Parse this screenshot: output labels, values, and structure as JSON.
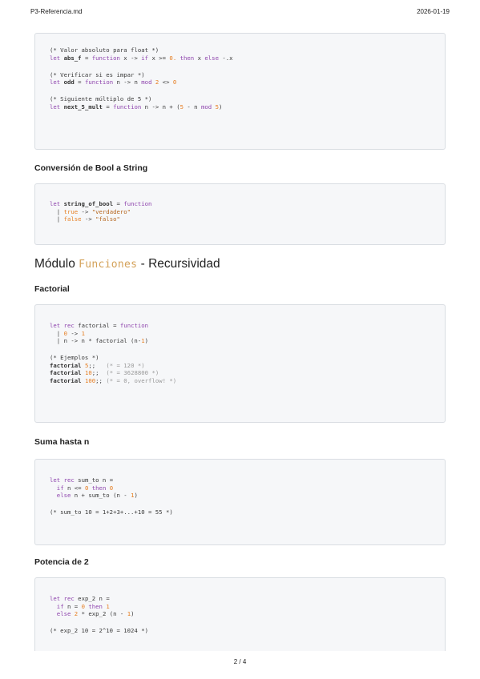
{
  "header": {
    "file": "P3-Referencia.md",
    "date": "2026-01-19"
  },
  "block1": {
    "c1": "(* Valor absoluto para float *)",
    "c2": "(* Verificar si es impar *)",
    "c3": "(* Siguiente múltiplo de 5 *)"
  },
  "sec_bool": {
    "title": "Conversión de Bool a String"
  },
  "block2": {
    "t": "\"verdadero\"",
    "f": "\"falso\""
  },
  "module": {
    "prefix": "Módulo ",
    "name": "Funciones",
    "suffix": " - Recursividad"
  },
  "sec_fact": {
    "title": "Factorial"
  },
  "block3": {
    "c1": "(* Ejemplos *)",
    "c2": "(* = 120 *)",
    "c3": "(* = 3628800 *)",
    "c4": "(* = 0, overflow! *)"
  },
  "sec_sum": {
    "title": "Suma hasta n"
  },
  "block4": {
    "c1": "(* sum_to 10 = 1+2+3+...+10 = 55 *)"
  },
  "sec_exp": {
    "title": "Potencia de 2"
  },
  "block5": {
    "c1": "(* exp_2 10 = 2^10 = 1024 *)"
  },
  "footer": {
    "page": "2 / 4"
  }
}
